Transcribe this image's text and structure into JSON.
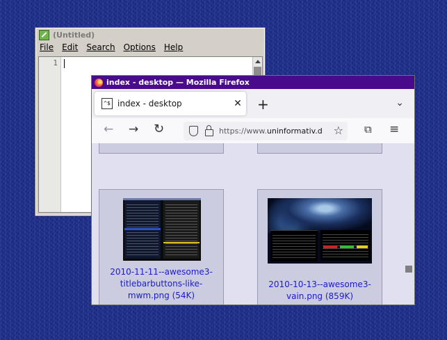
{
  "editor": {
    "title": "(Untitled)",
    "menu": [
      "File",
      "Edit",
      "Search",
      "Options",
      "Help"
    ],
    "line_number": "1"
  },
  "firefox": {
    "window_title": "index - desktop — Mozilla Firefox",
    "tab": {
      "favicon": "^$",
      "label": "index - desktop",
      "close": "✕"
    },
    "new_tab": "+",
    "tab_list": "⌄",
    "nav": {
      "back": "←",
      "forward": "→",
      "reload": "↻"
    },
    "url": {
      "prefix": "https://www.",
      "domain": "uninformativ.d"
    },
    "icons": {
      "star": "☆",
      "extensions": "⧉",
      "menu": "≡"
    },
    "gallery": [
      {
        "caption": "2010-11-11--awesome3-titlebarbuttons-like-mwm.png (54K)"
      },
      {
        "caption": "2010-10-13--awesome3-vain.png (859K)"
      }
    ]
  }
}
